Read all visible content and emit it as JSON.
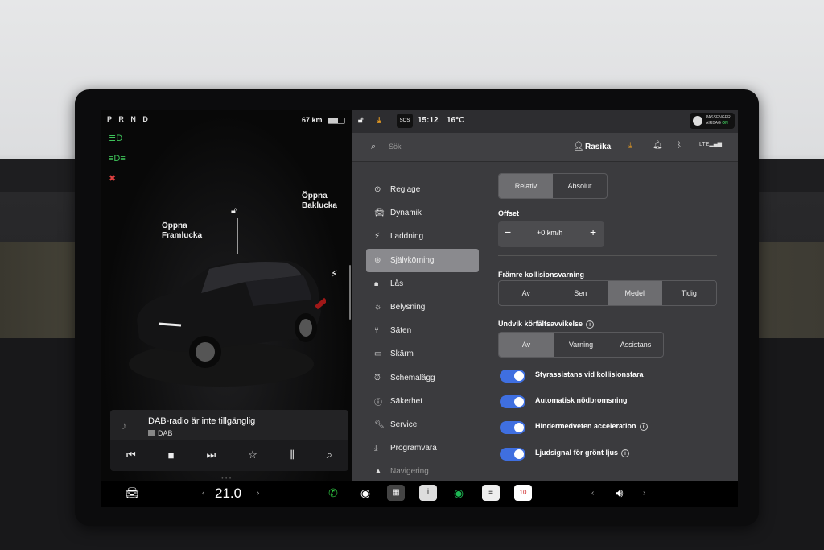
{
  "status": {
    "gear": "P R N D",
    "range": "67 km",
    "temperature": "16°C",
    "time": "15:12",
    "sos": "SOS",
    "airbag_line1": "PASSENGER",
    "airbag_line2": "AIRBAG",
    "airbag_state": "ON"
  },
  "car": {
    "front_trunk_1": "Öppna",
    "front_trunk_2": "Framlucka",
    "rear_trunk_1": "Öppna",
    "rear_trunk_2": "Baklucka"
  },
  "media": {
    "title": "DAB-radio är inte tillgänglig",
    "source": "DAB"
  },
  "search": {
    "placeholder": "Sök"
  },
  "user": {
    "name": "Rasika"
  },
  "nav": [
    {
      "label": "Reglage",
      "icon": "toggle-icon"
    },
    {
      "label": "Dynamik",
      "icon": "car-icon"
    },
    {
      "label": "Laddning",
      "icon": "bolt-icon"
    },
    {
      "label": "Självkörning",
      "icon": "steering-wheel-icon"
    },
    {
      "label": "Lås",
      "icon": "lock-icon"
    },
    {
      "label": "Belysning",
      "icon": "sun-icon"
    },
    {
      "label": "Säten",
      "icon": "seat-icon"
    },
    {
      "label": "Skärm",
      "icon": "display-icon"
    },
    {
      "label": "Schemalägg",
      "icon": "alarm-icon"
    },
    {
      "label": "Säkerhet",
      "icon": "info-icon"
    },
    {
      "label": "Service",
      "icon": "wrench-icon"
    },
    {
      "label": "Programvara",
      "icon": "download-icon"
    },
    {
      "label": "Navigering",
      "icon": "navigation-icon"
    }
  ],
  "autopilot": {
    "speed_mode": {
      "options": [
        "Relativ",
        "Absolut"
      ],
      "selected": "Relativ"
    },
    "offset_label": "Offset",
    "offset_value": "+0 km/h",
    "fcw_label": "Främre kollisionsvarning",
    "fcw": {
      "options": [
        "Av",
        "Sen",
        "Medel",
        "Tidig"
      ],
      "selected": "Medel"
    },
    "lane_label": "Undvik körfältsavvikelse",
    "lane": {
      "options": [
        "Av",
        "Varning",
        "Assistans"
      ],
      "selected": "Av"
    },
    "toggles": [
      {
        "label": "Styrassistans vid kollisionsfara",
        "on": true,
        "info": false
      },
      {
        "label": "Automatisk nödbromsning",
        "on": true,
        "info": false
      },
      {
        "label": "Hindermedveten acceleration",
        "on": true,
        "info": true
      },
      {
        "label": "Ljudsignal för grönt ljus",
        "on": true,
        "info": true
      }
    ]
  },
  "dock": {
    "temp": "21.0",
    "calendar_day": "10"
  },
  "colors": {
    "toggle_on": "#3f6fe0",
    "active_nav": "#8a8a8e"
  }
}
